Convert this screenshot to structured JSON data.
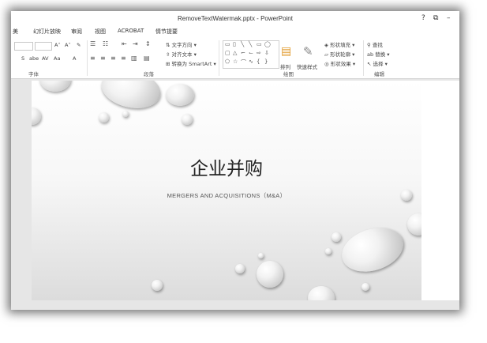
{
  "window": {
    "title": "RemoveTextWatermak.pptx - PowerPoint"
  },
  "controls": {
    "help": "?",
    "restore": "⧉",
    "minimize": "–"
  },
  "tabs": [
    "幻灯片放映",
    "审阅",
    "视图",
    "ACROBAT",
    "情节提要"
  ],
  "tab_partial": "美",
  "ribbon": {
    "font": {
      "grow": "A˄",
      "shrink": "A˅",
      "clear": "✎",
      "shadow": "S",
      "strike": "abe",
      "spacing": "AV",
      "case": "Aa",
      "color": "A",
      "label": "字体"
    },
    "paragraph": {
      "text_direction": "文字方向",
      "align_text": "对齐文本",
      "smartart": "转换为 SmartArt",
      "label": "段落"
    },
    "drawing": {
      "arrange": "排列",
      "quick_styles": "快速样式",
      "shape_fill": "形状填充",
      "shape_outline": "形状轮廓",
      "shape_effects": "形状效果",
      "label": "绘图"
    },
    "editing": {
      "find": "查找",
      "replace": "替换",
      "select": "选择",
      "label": "编辑"
    }
  },
  "slide": {
    "title": "企业并购",
    "subtitle": "MERGERS AND ACQUISITIONS（M&A）"
  }
}
